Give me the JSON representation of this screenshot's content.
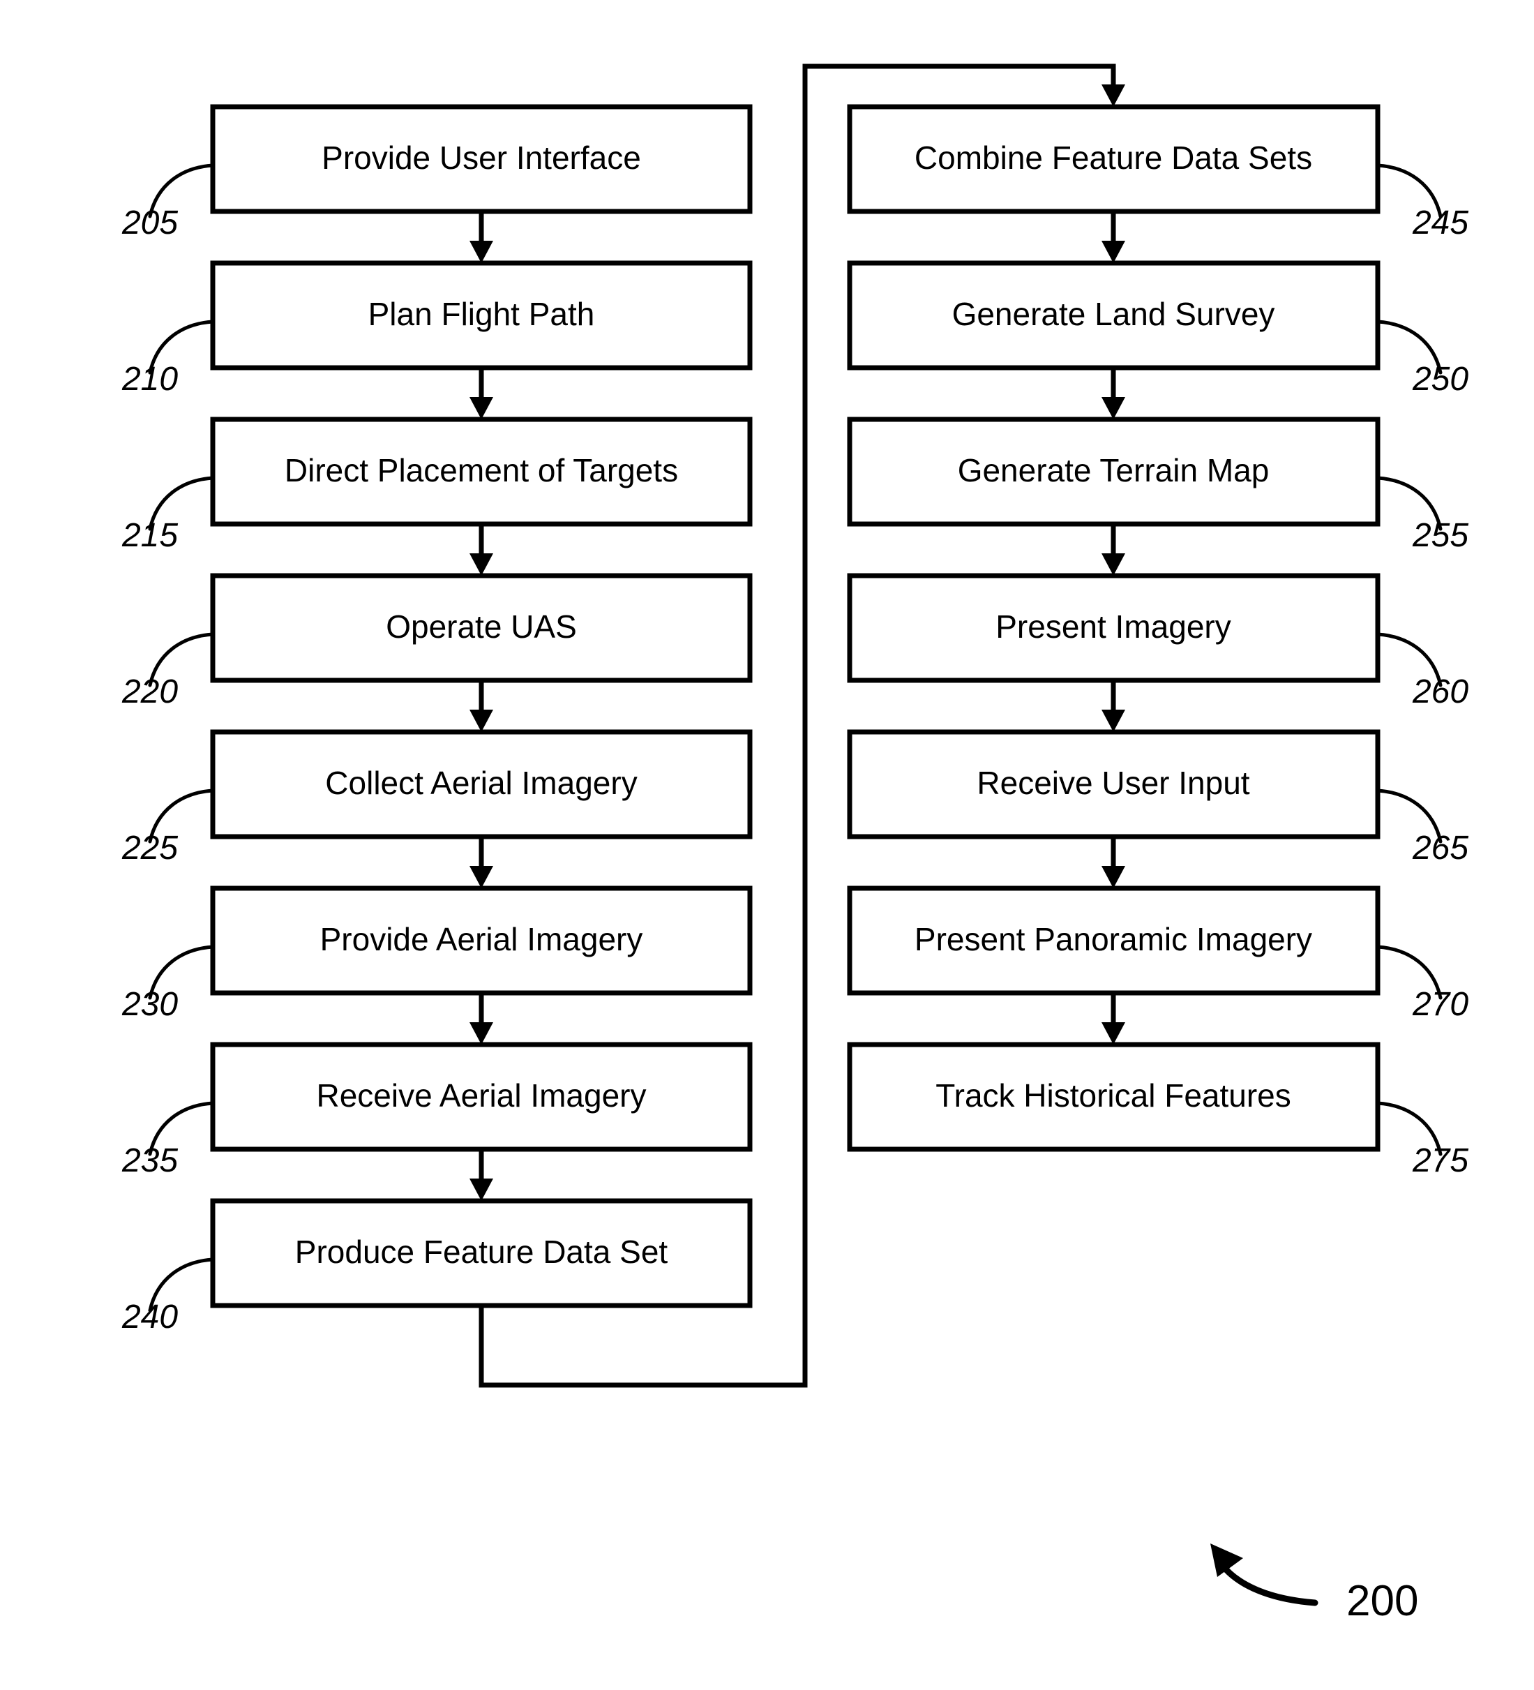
{
  "figure": {
    "number": "200",
    "type": "patent-flowchart",
    "background_color": "#ffffff",
    "line_color": "#000000"
  },
  "columns": [
    {
      "id": "left-column",
      "steps": [
        {
          "ref": "205",
          "label": "Provide User Interface"
        },
        {
          "ref": "210",
          "label": "Plan Flight Path"
        },
        {
          "ref": "215",
          "label": "Direct Placement of Targets"
        },
        {
          "ref": "220",
          "label": "Operate UAS"
        },
        {
          "ref": "225",
          "label": "Collect Aerial Imagery"
        },
        {
          "ref": "230",
          "label": "Provide Aerial Imagery"
        },
        {
          "ref": "235",
          "label": "Receive Aerial Imagery"
        },
        {
          "ref": "240",
          "label": "Produce Feature Data Set"
        }
      ]
    },
    {
      "id": "right-column",
      "steps": [
        {
          "ref": "245",
          "label": "Combine Feature Data Sets"
        },
        {
          "ref": "250",
          "label": "Generate Land Survey"
        },
        {
          "ref": "255",
          "label": "Generate Terrain Map"
        },
        {
          "ref": "260",
          "label": "Present Imagery"
        },
        {
          "ref": "265",
          "label": "Receive User Input"
        },
        {
          "ref": "270",
          "label": "Present Panoramic Imagery"
        },
        {
          "ref": "275",
          "label": "Track Historical Features"
        }
      ]
    }
  ],
  "connectors": {
    "left_chain": "sequential-down-arrows",
    "right_chain": "sequential-down-arrows",
    "return_path_label": "wrap-from-produce-feature-data-set-to-combine-feature-data-sets"
  }
}
